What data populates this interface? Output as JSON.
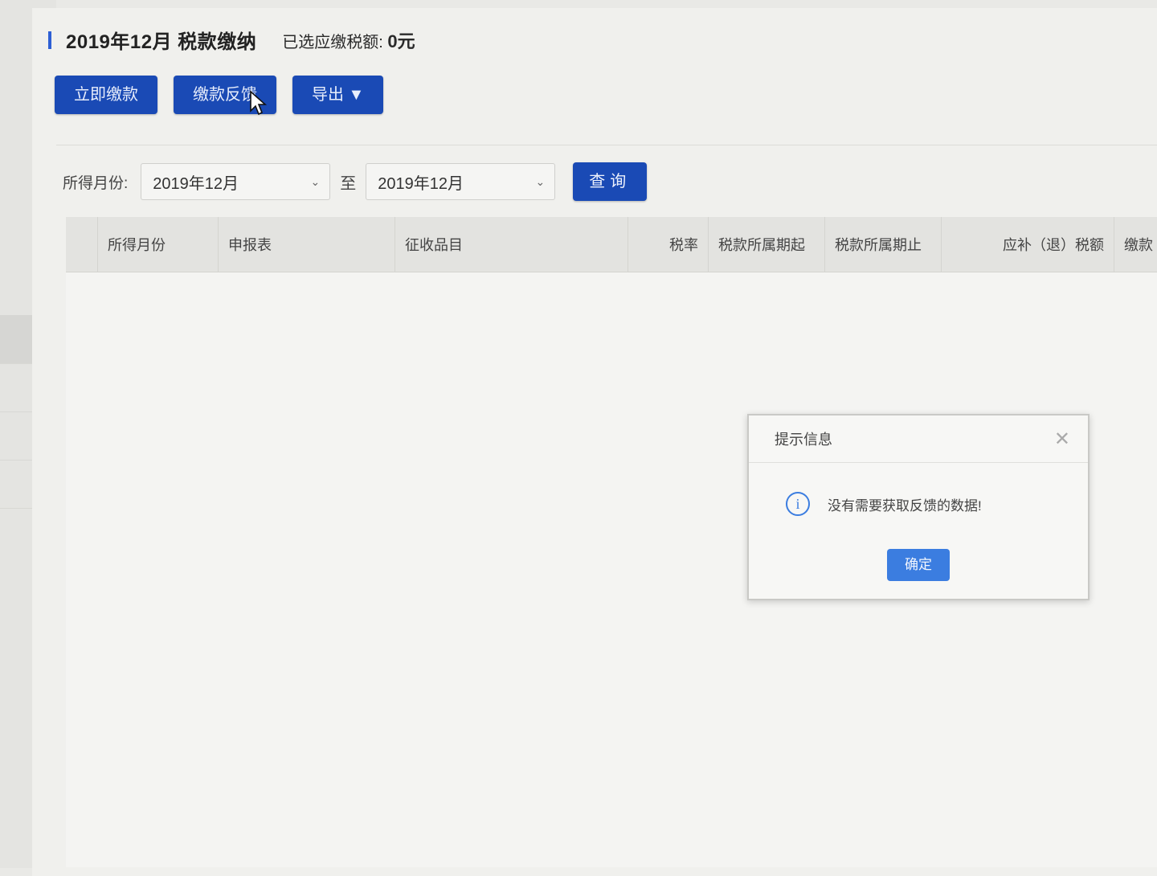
{
  "header": {
    "title": "2019年12月 税款缴纳",
    "selected_amount_label": "已选应缴税额:",
    "selected_amount_value": "0元"
  },
  "toolbar": {
    "pay_now_label": "立即缴款",
    "payment_feedback_label": "缴款反馈",
    "export_label": "导出 ▼"
  },
  "filter": {
    "label": "所得月份:",
    "from_value": "2019年12月",
    "to_label": "至",
    "to_value": "2019年12月",
    "query_label": "查询"
  },
  "table": {
    "columns": [
      "所得月份",
      "申报表",
      "征收品目",
      "税率",
      "税款所属期起",
      "税款所属期止",
      "应补（退）税额",
      "缴款"
    ],
    "rows": []
  },
  "dialog": {
    "title": "提示信息",
    "message": "没有需要获取反馈的数据!",
    "ok_label": "确定"
  },
  "colors": {
    "primary_button": "#1a4ab5",
    "dialog_accent": "#3b7de0",
    "title_accent": "#2d5fd4"
  }
}
